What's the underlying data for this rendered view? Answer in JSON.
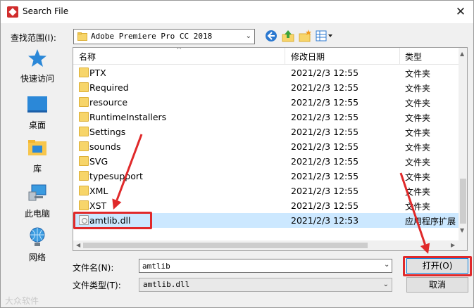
{
  "window": {
    "title": "Search File",
    "close_glyph": "✕"
  },
  "lookin": {
    "label": "查找范围(I):",
    "value": "Adobe Premiere Pro CC 2018",
    "arrow_glyph": "⌄"
  },
  "nav_icons": [
    "back-icon",
    "up-folder-icon",
    "new-folder-icon",
    "view-menu-icon"
  ],
  "places": [
    {
      "label": "快速访问",
      "icon": "star-icon"
    },
    {
      "label": "桌面",
      "icon": "desktop-icon"
    },
    {
      "label": "库",
      "icon": "library-icon"
    },
    {
      "label": "此电脑",
      "icon": "computer-icon"
    },
    {
      "label": "网络",
      "icon": "network-icon"
    }
  ],
  "columns": {
    "name": "名称",
    "date": "修改日期",
    "type": "类型"
  },
  "rows": [
    {
      "name": "PTX",
      "date": "2021/2/3 12:55",
      "type": "文件夹",
      "icon": "folder-icon"
    },
    {
      "name": "Required",
      "date": "2021/2/3 12:55",
      "type": "文件夹",
      "icon": "folder-icon"
    },
    {
      "name": "resource",
      "date": "2021/2/3 12:55",
      "type": "文件夹",
      "icon": "folder-icon"
    },
    {
      "name": "RuntimeInstallers",
      "date": "2021/2/3 12:55",
      "type": "文件夹",
      "icon": "folder-icon"
    },
    {
      "name": "Settings",
      "date": "2021/2/3 12:55",
      "type": "文件夹",
      "icon": "folder-icon"
    },
    {
      "name": "sounds",
      "date": "2021/2/3 12:55",
      "type": "文件夹",
      "icon": "folder-icon"
    },
    {
      "name": "SVG",
      "date": "2021/2/3 12:55",
      "type": "文件夹",
      "icon": "folder-icon"
    },
    {
      "name": "typesupport",
      "date": "2021/2/3 12:55",
      "type": "文件夹",
      "icon": "folder-icon"
    },
    {
      "name": "XML",
      "date": "2021/2/3 12:55",
      "type": "文件夹",
      "icon": "folder-icon"
    },
    {
      "name": "XST",
      "date": "2021/2/3 12:55",
      "type": "文件夹",
      "icon": "folder-icon"
    },
    {
      "name": "amtlib.dll",
      "date": "2021/2/3 12:53",
      "type": "应用程序扩展",
      "icon": "dll-file-icon",
      "selected": true
    }
  ],
  "filename": {
    "label": "文件名(N):",
    "value": "amtlib"
  },
  "filetype": {
    "label": "文件类型(T):",
    "value": "amtlib.dll"
  },
  "buttons": {
    "open": "打开(O)",
    "cancel": "取消"
  },
  "annotation_color": "#e0292a",
  "watermark": "大众软件"
}
